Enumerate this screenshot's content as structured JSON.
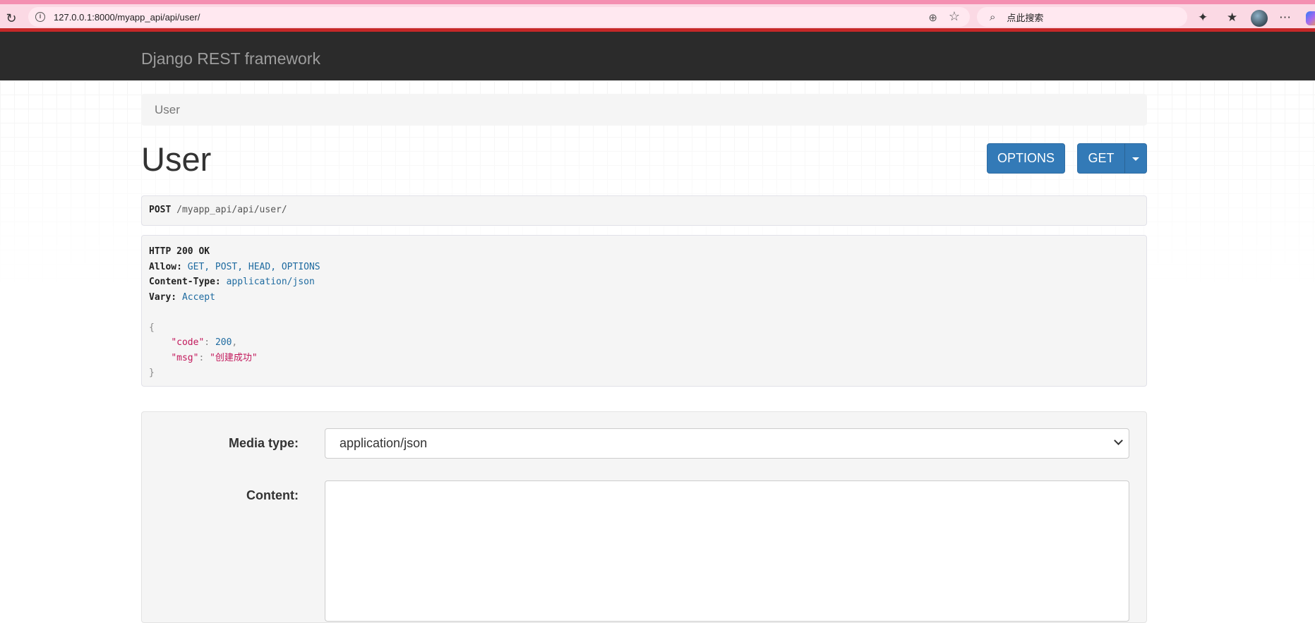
{
  "browser": {
    "url": "127.0.0.1:8000/myapp_api/api/user/",
    "search_placeholder": "点此搜索"
  },
  "navbar": {
    "brand": "Django REST framework"
  },
  "breadcrumb": {
    "current": "User"
  },
  "page": {
    "title": "User"
  },
  "toolbar": {
    "options_label": "OPTIONS",
    "get_label": "GET"
  },
  "request": {
    "method": "POST",
    "path": "/myapp_api/api/user/"
  },
  "response": {
    "status_line": "HTTP 200 OK",
    "headers": [
      {
        "name": "Allow:",
        "value": "GET, POST, HEAD, OPTIONS"
      },
      {
        "name": "Content-Type:",
        "value": "application/json"
      },
      {
        "name": "Vary:",
        "value": "Accept"
      }
    ],
    "body": {
      "code_key": "\"code\"",
      "code_value": "200",
      "msg_key": "\"msg\"",
      "msg_value": "\"创建成功\""
    }
  },
  "form": {
    "media_type_label": "Media type:",
    "media_type_value": "application/json",
    "content_label": "Content:",
    "content_value": ""
  },
  "colors": {
    "navbar_bg": "#2b2b2b",
    "button_primary": "#337ab7",
    "header_value": "#1f6ba0",
    "json_string": "#c2185b"
  }
}
